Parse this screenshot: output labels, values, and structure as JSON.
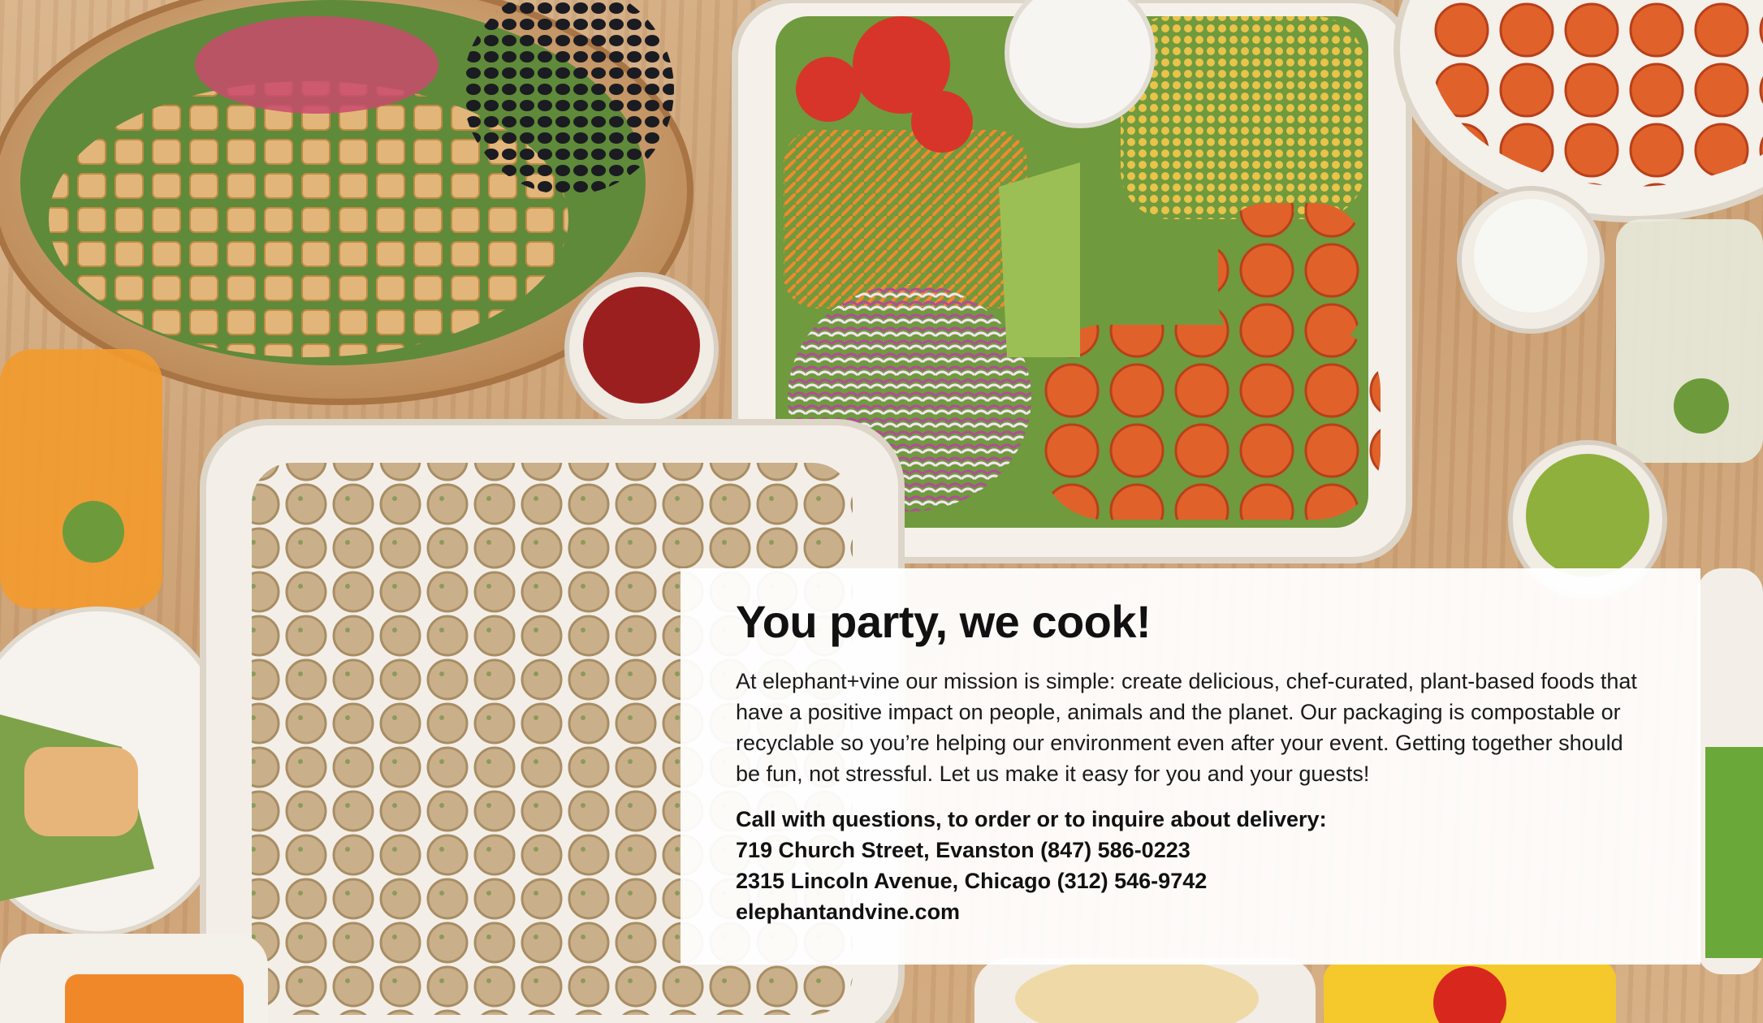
{
  "background": {
    "description_icon": "food-spread-photo",
    "wood_color": "#c99d70"
  },
  "card": {
    "headline": "You party, we cook!",
    "mission": "At elephant+vine our mission is simple: create delicious, chef-curated, plant-based foods that have a positive impact on people, animals and the planet. Our packaging is compostable or recyclable so you’re helping our environment even after your event. Getting together should be fun, not stressful. Let us make it easy for you and your guests!",
    "contact_intro": "Call with questions, to order or to inquire about delivery:",
    "location_1": "719 Church Street, Evanston (847) 586-0223",
    "location_2": "2315 Lincoln Avenue, Chicago (312) 546-9742",
    "website": "elephantandvine.com"
  }
}
